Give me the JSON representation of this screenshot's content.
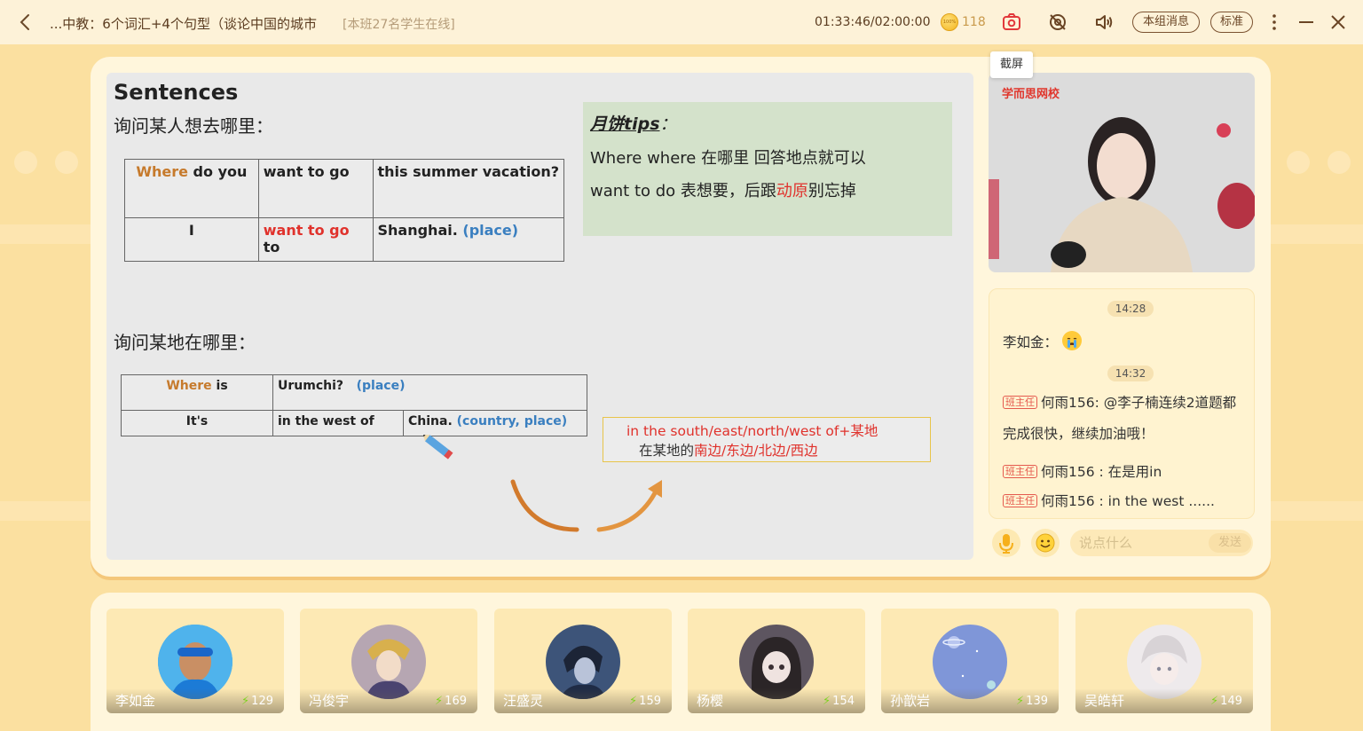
{
  "header": {
    "back_icon": "chevron-left-icon",
    "title": "...中教：6个词汇+4个句型（谈论中国的城市",
    "online_status": "[本班27名学生在线]",
    "timer": "01:33:46/02:00:00",
    "coin_label": "100%",
    "coin_count": "118",
    "screenshot_tooltip": "截屏",
    "group_message_label": "本组消息",
    "quality_label": "标准",
    "icons": [
      "camera-icon",
      "eye-off-icon",
      "speaker-icon",
      "more-vertical-icon",
      "minimize-icon",
      "close-icon"
    ]
  },
  "slide": {
    "title": "Sentences",
    "section1_heading": "询问某人想去哪里：",
    "table1": {
      "r1c1a": "Where",
      "r1c1b": " do you",
      "r1c2": "want to go",
      "r1c3": "this summer vacation?",
      "r2c1": "I",
      "r2c2a": "want to go",
      "r2c2b": " to",
      "r2c3a": "Shanghai.",
      "r2c3b": " (place)"
    },
    "tips": {
      "head_word": "月饼tips",
      "head_colon": "：",
      "line1": "Where  where 在哪里 回答地点就可以",
      "line2_a": "want to do 表想要，后跟",
      "line2_b": "动原",
      "line2_c": "别忘掉"
    },
    "section2_heading": "询问某地在哪里：",
    "table2": {
      "r1c1a": "Where",
      "r1c1b": " is",
      "r1c2a": "Urumchi?",
      "r1c2b": "(place)",
      "r2c1": "It's",
      "r2c2": "in the west of",
      "r2c3a": "China.",
      "r2c3b": " (country, place)"
    },
    "directions": {
      "line1": "in the south/east/north/west of+某地",
      "line2_a": "在某地的",
      "line2_b": "南边/东边/北边/西边"
    },
    "colors": {
      "orange": "#c67a2c",
      "red": "#e0322c",
      "blue": "#3a7fc0",
      "tips_bg": "#d4e2cb"
    }
  },
  "video": {
    "logo": "学而思网校"
  },
  "chat": {
    "messages": [
      {
        "time": "14:28"
      },
      {
        "sender": "李如金",
        "sep": "：",
        "emoji": "crying-face-icon"
      },
      {
        "time": "14:32"
      },
      {
        "badge": "班主任",
        "sender": "何雨156",
        "text": ": @李子楠连续2道题都",
        "text2": "完成很快，继续加油哦！"
      },
      {
        "badge": "班主任",
        "sender": "何雨156",
        "text": " : 在是用in"
      },
      {
        "badge": "班主任",
        "sender": "何雨156",
        "text": " : in the west ......"
      }
    ],
    "input_placeholder": "说点什么",
    "send_label": "发送"
  },
  "students": [
    {
      "name": "李如金",
      "points": "129",
      "color": "#3aa7e6"
    },
    {
      "name": "冯俊宇",
      "points": "169",
      "color": "#8d7a8a"
    },
    {
      "name": "汪盛灵",
      "points": "159",
      "color": "#3d5479"
    },
    {
      "name": "杨樱",
      "points": "154",
      "color": "#5d5560"
    },
    {
      "name": "孙歆岩",
      "points": "139",
      "color": "#7f96d8"
    },
    {
      "name": "吴皓轩",
      "points": "149",
      "color": "#e6e2e4"
    }
  ]
}
